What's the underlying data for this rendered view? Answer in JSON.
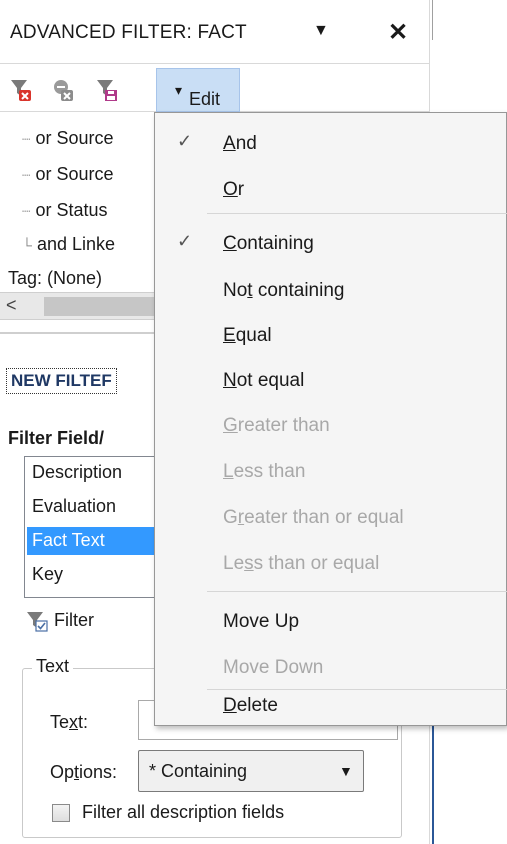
{
  "window": {
    "title": "ADVANCED FILTER:  FACT",
    "dropdown_glyph": "▼",
    "close_glyph": "✕"
  },
  "toolbar": {
    "icons": [
      "filter-remove-icon",
      "filter-clear-icon",
      "filter-save-icon"
    ],
    "edit_label": "Edit",
    "edit_arrow": "▾"
  },
  "tree": {
    "items": [
      {
        "connector": "┈",
        "text": "or Source"
      },
      {
        "connector": "┈",
        "text": "or Source"
      },
      {
        "connector": "┈",
        "text": "or Status"
      },
      {
        "connector": "└",
        "text": "and Linke"
      }
    ],
    "tag_text": "Tag: (None)",
    "scroll_left_glyph": "<"
  },
  "new_filter": {
    "label": "NEW FILTEF",
    "field_label": "Filter Field/",
    "fields": [
      "Description",
      "Evaluation",
      "Fact Text",
      "Key"
    ],
    "selected_field": "Fact Text",
    "filter_button": "Filter"
  },
  "text_group": {
    "legend": "Text",
    "text_label_pre": "Te",
    "text_label_ul": "x",
    "text_label_post": "t:",
    "text_value": "",
    "options_label_pre": "Op",
    "options_label_ul": "t",
    "options_label_post": "ions:",
    "options_value": "* Containing",
    "options_arrow": "▼",
    "filter_all_label": "Filter all description fields",
    "filter_all_checked": false
  },
  "menu": {
    "check_glyph": "✓",
    "items": [
      {
        "pre": "",
        "ul": "A",
        "post": "nd",
        "checked": true,
        "enabled": true
      },
      {
        "pre": "",
        "ul": "O",
        "post": "r",
        "checked": false,
        "enabled": true
      },
      {
        "pre": "",
        "ul": "C",
        "post": "ontaining",
        "checked": true,
        "enabled": true
      },
      {
        "pre": "No",
        "ul": "t",
        "post": " containing",
        "checked": false,
        "enabled": true
      },
      {
        "pre": "",
        "ul": "E",
        "post": "qual",
        "checked": false,
        "enabled": true
      },
      {
        "pre": "",
        "ul": "N",
        "post": "ot equal",
        "checked": false,
        "enabled": true
      },
      {
        "pre": "",
        "ul": "G",
        "post": "reater than",
        "checked": false,
        "enabled": false
      },
      {
        "pre": "",
        "ul": "L",
        "post": "ess than",
        "checked": false,
        "enabled": false
      },
      {
        "pre": "G",
        "ul": "r",
        "post": "eater than or equal",
        "checked": false,
        "enabled": false
      },
      {
        "pre": "Le",
        "ul": "s",
        "post": "s than or equal",
        "checked": false,
        "enabled": false
      },
      {
        "pre": "",
        "ul": "",
        "post": "Move Up",
        "checked": false,
        "enabled": true
      },
      {
        "pre": "",
        "ul": "",
        "post": "Move Down",
        "checked": false,
        "enabled": false
      },
      {
        "pre": "",
        "ul": "D",
        "post": "elete",
        "checked": false,
        "enabled": true
      }
    ]
  },
  "colors": {
    "selection": "#3399ff",
    "edit_button_bg": "#c9def5",
    "disabled_text": "#a8a8a8",
    "new_filter_label": "#1f3864"
  }
}
